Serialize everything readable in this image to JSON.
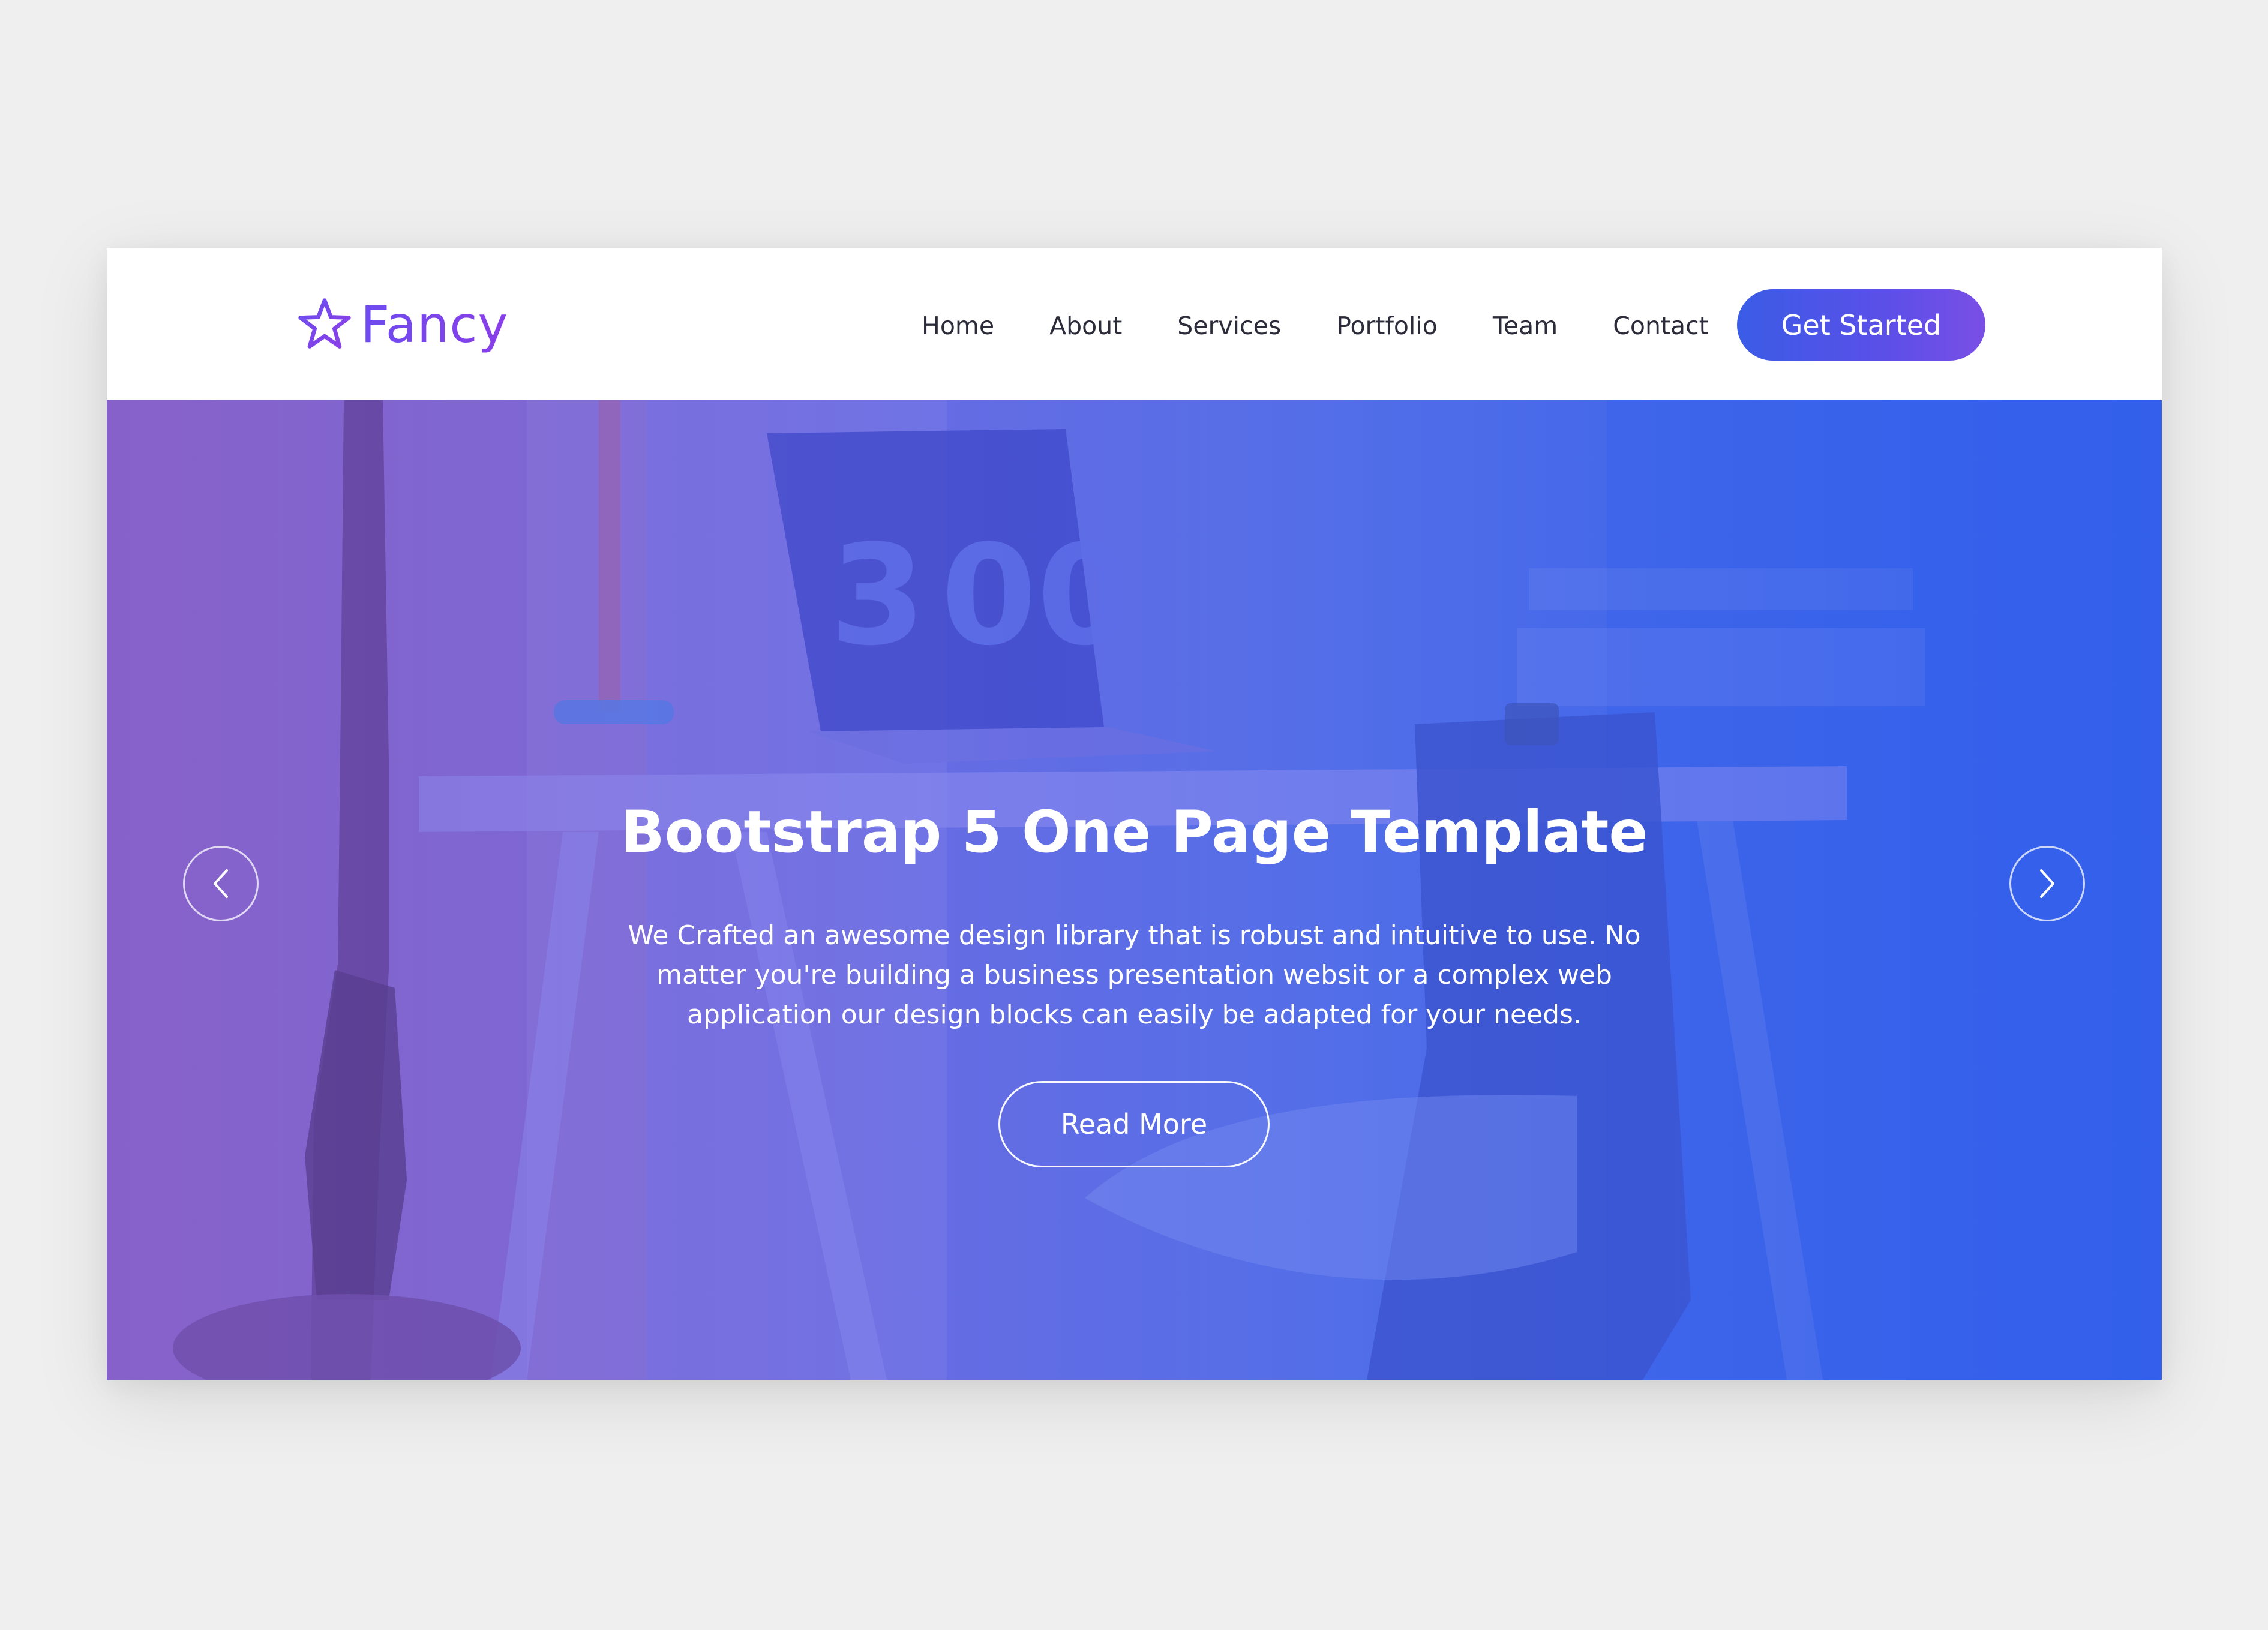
{
  "brand": {
    "name": "Fancy",
    "icon": "star-outline-icon",
    "color_start": "#6d4bf0",
    "color_end": "#8a3ee8"
  },
  "nav": {
    "items": [
      {
        "label": "Home"
      },
      {
        "label": "About"
      },
      {
        "label": "Services"
      },
      {
        "label": "Portfolio"
      },
      {
        "label": "Team"
      },
      {
        "label": "Contact"
      }
    ],
    "cta_label": "Get Started",
    "cta_color": "#3a5ce6"
  },
  "hero": {
    "title": "Bootstrap 5 One Page Template",
    "description": "We Crafted an awesome design library that is robust and intuitive to use. No matter you're building a business presentation websit or a complex web application our design blocks can easily be adapted for your needs.",
    "button_label": "Read More",
    "prev_icon": "chevron-left-icon",
    "next_icon": "chevron-right-icon",
    "gradient_start": "#8a62c8",
    "gradient_end": "#3460ec"
  }
}
